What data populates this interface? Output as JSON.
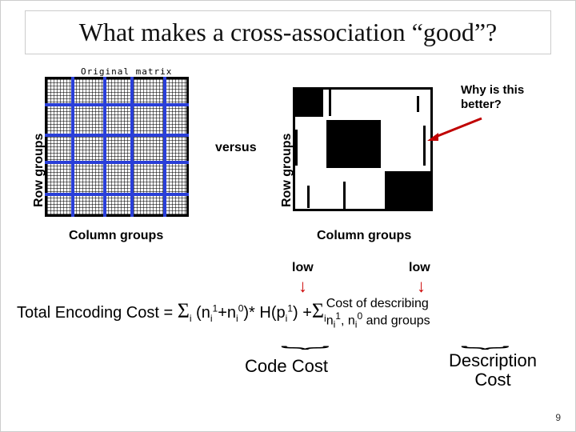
{
  "title": "What makes a cross-association “good”?",
  "matrix_title": "Original matrix",
  "row_groups_label": "Row groups",
  "versus": "versus",
  "why_text": "Why is this better?",
  "column_groups_label": "Column groups",
  "low": "low",
  "formula": {
    "lhs": "Total Encoding Cost = ",
    "sigma1": "Σ",
    "sub_i": "i",
    "term_open": " (n",
    "sup1": "1",
    "plus_n": "+n",
    "sup0": "0",
    "close_h": ")* H(p",
    "close_paren": ")",
    "plus": " +",
    "desc_line1": " Cost of describing",
    "desc_line2_a": " n",
    "desc_line2_b": ", n",
    "desc_line2_c": " and groups"
  },
  "code_cost": "Code Cost",
  "description_cost": "Description Cost",
  "page_number": "9"
}
